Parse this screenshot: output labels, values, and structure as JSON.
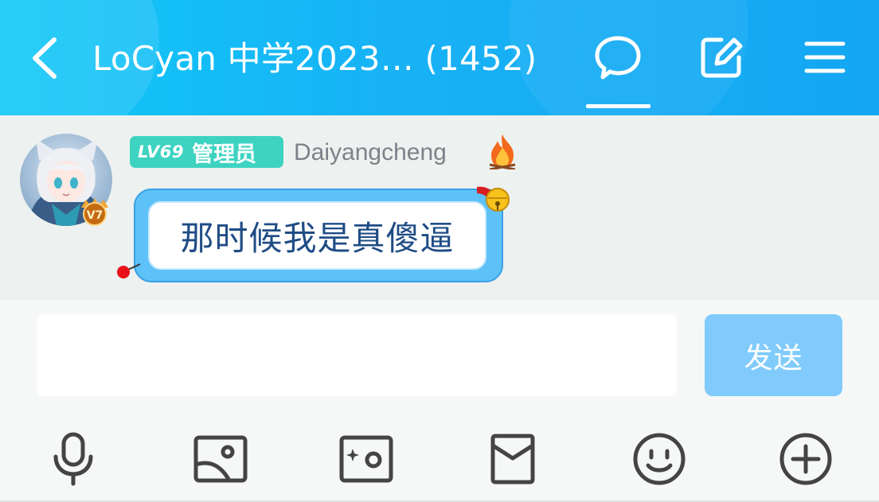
{
  "header": {
    "title": "LoCyan 中学2023… (1452)",
    "icons": [
      "back-arrow-icon",
      "chat-bubble-icon",
      "edit-icon",
      "menu-icon"
    ],
    "colors": {
      "gradient_start": "#10c8f7",
      "gradient_end": "#14a6f3"
    }
  },
  "message": {
    "level": "LV69",
    "role": "管理员",
    "username": "Daiyangcheng",
    "vip_badge": "V7",
    "text": "那时候我是真傻逼",
    "colors": {
      "level_badge": "#3ed3c1",
      "bubble": "#5ec2f8",
      "text": "#1f4c85"
    }
  },
  "input": {
    "value": "",
    "placeholder": "",
    "send_label": "发送",
    "send_color": "#80cbfc"
  },
  "toolbar": {
    "items": [
      "microphone-icon",
      "image-icon",
      "camera-icon",
      "red-packet-icon",
      "emoji-icon",
      "plus-icon"
    ]
  }
}
